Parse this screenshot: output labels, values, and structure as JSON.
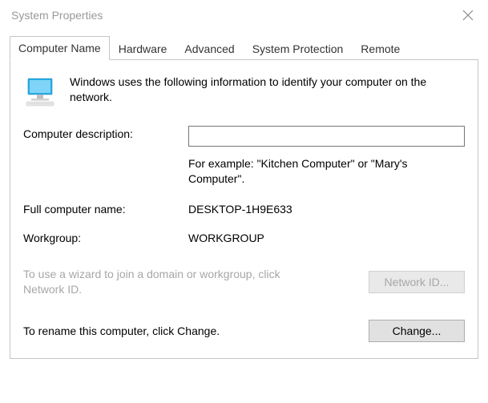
{
  "window": {
    "title": "System Properties"
  },
  "tabs": {
    "computer_name": "Computer Name",
    "hardware": "Hardware",
    "advanced": "Advanced",
    "system_protection": "System Protection",
    "remote": "Remote"
  },
  "intro_text": "Windows uses the following information to identify your computer on the network.",
  "fields": {
    "description_label": "Computer description:",
    "description_value": "",
    "example_text": "For example: \"Kitchen Computer\" or \"Mary's Computer\".",
    "full_name_label": "Full computer name:",
    "full_name_value": "DESKTOP-1H9E633",
    "workgroup_label": "Workgroup:",
    "workgroup_value": "WORKGROUP"
  },
  "wizard": {
    "text": "To use a wizard to join a domain or workgroup, click Network ID.",
    "button": "Network ID..."
  },
  "change": {
    "text": "To rename this computer, click Change.",
    "button": "Change..."
  }
}
